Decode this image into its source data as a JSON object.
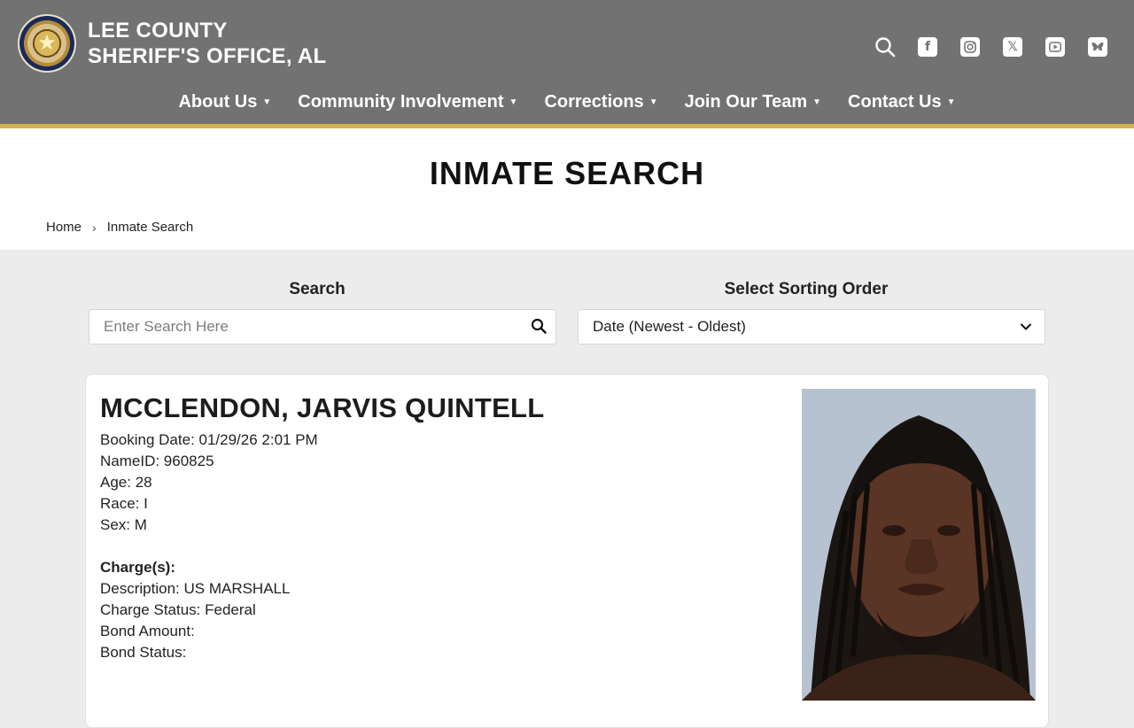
{
  "header": {
    "title_line1": "LEE COUNTY",
    "title_line2": "SHERIFF'S OFFICE, AL",
    "icons": [
      "search-icon",
      "facebook-icon",
      "instagram-icon",
      "x-icon",
      "youtube-icon",
      "bluesky-icon"
    ]
  },
  "nav": [
    {
      "label": "About Us"
    },
    {
      "label": "Community Involvement"
    },
    {
      "label": "Corrections"
    },
    {
      "label": "Join Our Team"
    },
    {
      "label": "Contact Us"
    }
  ],
  "page": {
    "title": "INMATE SEARCH",
    "breadcrumb": [
      "Home",
      "Inmate Search"
    ]
  },
  "search": {
    "label": "Search",
    "placeholder": "Enter Search Here",
    "value": ""
  },
  "sort": {
    "label": "Select Sorting Order",
    "selected": "Date (Newest - Oldest)"
  },
  "inmate": {
    "name": "MCCLENDON, JARVIS QUINTELL",
    "booking_date": "Booking Date: 01/29/26 2:01 PM",
    "name_id": "NameID: 960825",
    "age": "Age: 28",
    "race": "Race: I",
    "sex": "Sex: M",
    "charges_heading": "Charge(s):",
    "description": "Description: US MARSHALL",
    "charge_status": "Charge Status: Federal",
    "bond_amount": "Bond Amount:",
    "bond_status": "Bond Status:"
  },
  "colors": {
    "header_bg": "#727272",
    "accent": "#d4b24a",
    "page_bg": "#ececec"
  }
}
